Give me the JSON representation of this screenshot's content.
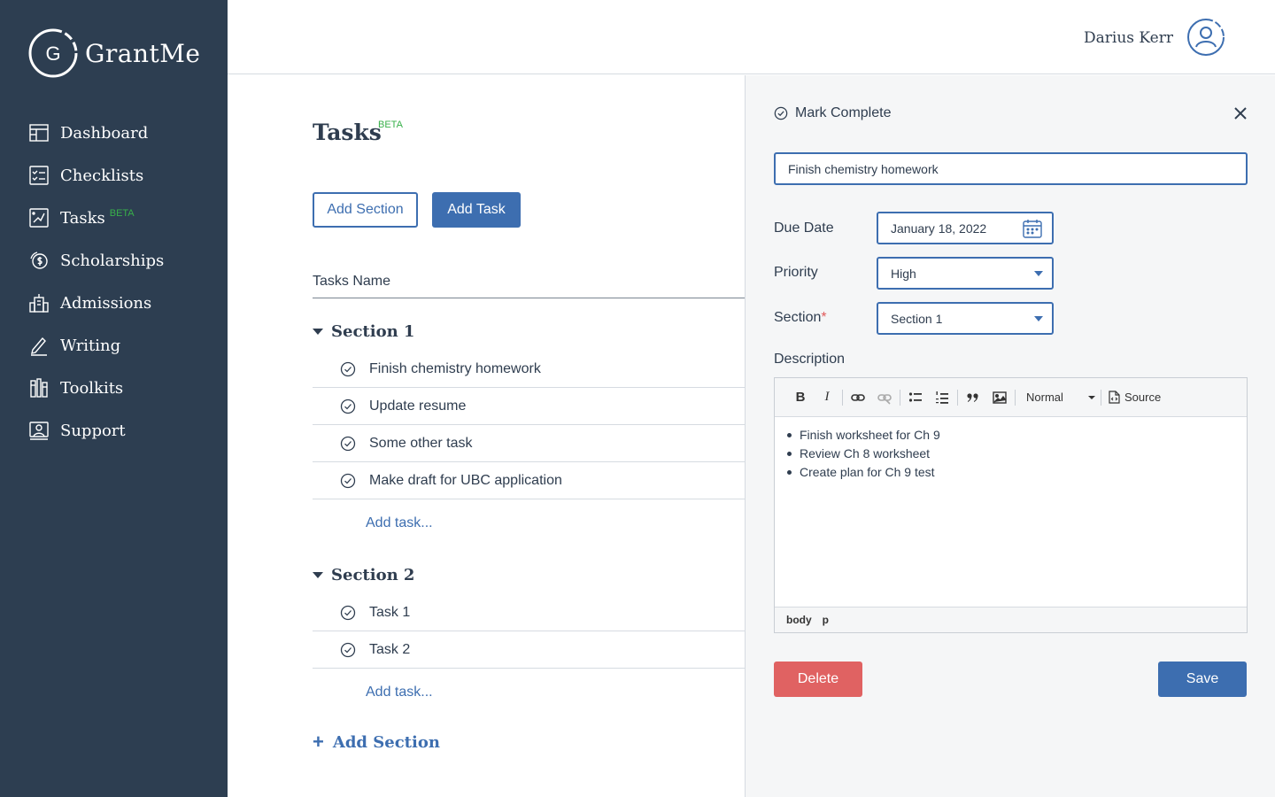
{
  "app": {
    "name": "GrantMe",
    "logo_letter": "G"
  },
  "sidebar": {
    "items": [
      {
        "label": "Dashboard",
        "icon": "dashboard-icon"
      },
      {
        "label": "Checklists",
        "icon": "checklist-icon"
      },
      {
        "label": "Tasks",
        "icon": "tasks-icon",
        "badge": "BETA"
      },
      {
        "label": "Scholarships",
        "icon": "scholarship-icon"
      },
      {
        "label": "Admissions",
        "icon": "admissions-icon"
      },
      {
        "label": "Writing",
        "icon": "pencil-icon"
      },
      {
        "label": "Toolkits",
        "icon": "toolkit-icon"
      },
      {
        "label": "Support",
        "icon": "support-icon"
      }
    ]
  },
  "header": {
    "user_name": "Darius Kerr",
    "avatar_icon": "user-avatar-icon"
  },
  "main": {
    "title": "Tasks",
    "title_badge": "BETA",
    "add_section_label": "Add Section",
    "add_task_label": "Add Task",
    "column_header": "Tasks Name",
    "sections": [
      {
        "name": "Section 1",
        "tasks": [
          "Finish chemistry homework",
          "Update resume",
          "Some other task",
          "Make draft for UBC application"
        ],
        "add_task": "Add task..."
      },
      {
        "name": "Section 2",
        "tasks": [
          "Task 1",
          "Task 2"
        ],
        "add_task": "Add task..."
      }
    ],
    "add_section_link": "Add Section"
  },
  "panel": {
    "mark_complete": "Mark Complete",
    "task_title": "Finish chemistry homework",
    "due_date_label": "Due Date",
    "due_date_value": "January 18, 2022",
    "priority_label": "Priority",
    "priority_value": "High",
    "section_label": "Section",
    "section_required": "*",
    "section_value": "Section 1",
    "description_label": "Description",
    "editor": {
      "format_value": "Normal",
      "source_label": "Source",
      "content": [
        "Finish worksheet for Ch 9",
        "Review Ch 8 worksheet",
        "Create plan for Ch 9 test"
      ],
      "path": [
        "body",
        "p"
      ]
    },
    "delete_label": "Delete",
    "save_label": "Save"
  },
  "colors": {
    "sidebar_bg": "#2d3e51",
    "primary": "#3d6eb0",
    "beta": "#38b04a",
    "danger": "#e06262"
  }
}
